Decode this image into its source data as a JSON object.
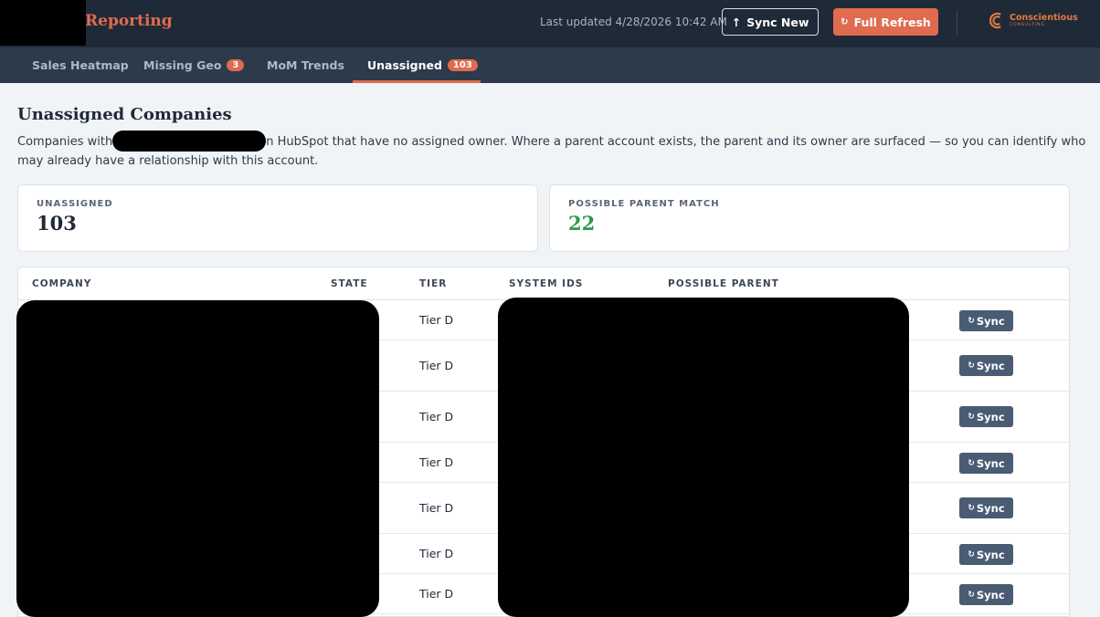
{
  "header": {
    "title": "Reporting",
    "last_updated": "Last updated 4/28/2026 10:42 AM",
    "sync_new_label": "Sync New",
    "sync_new_icon": "arrow-up-icon",
    "full_refresh_label": "Full Refresh",
    "full_refresh_icon": "refresh-icon",
    "brand_name": "Conscientious",
    "brand_sub": "CONSULTING",
    "accent_color": "#e06b4f"
  },
  "tabs": [
    {
      "label": "Sales Heatmap",
      "badge": null
    },
    {
      "label": "Missing Geo",
      "badge": "3"
    },
    {
      "label": "MoM Trends",
      "badge": null
    },
    {
      "label": "Unassigned",
      "badge": "103",
      "active": true
    }
  ],
  "page": {
    "title": "Unassigned Companies",
    "desc_start": "Companies with",
    "desc_end": "n HubSpot that have no assigned owner. Where a parent account exists, the parent and its owner are surfaced — so you can identify who may already have a relationship with this account."
  },
  "stats": {
    "unassigned_label": "UNASSIGNED",
    "unassigned_value": "103",
    "parent_label": "POSSIBLE PARENT MATCH",
    "parent_value": "22",
    "parent_color": "#2e9a4f"
  },
  "table": {
    "columns": [
      "COMPANY",
      "STATE",
      "TIER",
      "SYSTEM IDS",
      "POSSIBLE PARENT"
    ],
    "sync_label": "Sync",
    "rows": [
      {
        "tier": "Tier D"
      },
      {
        "tier": "Tier D"
      },
      {
        "tier": "Tier D"
      },
      {
        "tier": "Tier D"
      },
      {
        "tier": "Tier D"
      },
      {
        "tier": "Tier D"
      },
      {
        "tier": "Tier D"
      }
    ]
  }
}
